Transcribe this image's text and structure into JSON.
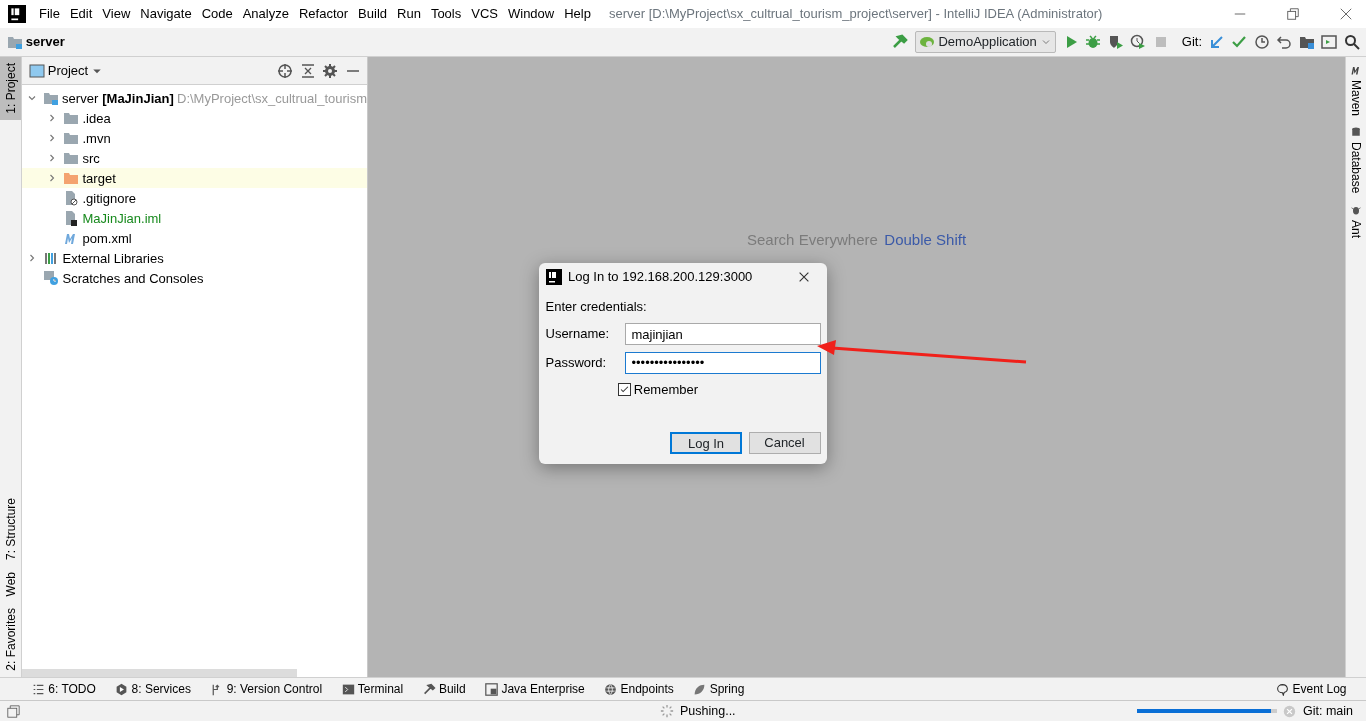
{
  "window": {
    "title": "server [D:\\MyProject\\sx_cultrual_tourism_project\\server] - IntelliJ IDEA (Administrator)",
    "menu": [
      "File",
      "Edit",
      "View",
      "Navigate",
      "Code",
      "Analyze",
      "Refactor",
      "Build",
      "Run",
      "Tools",
      "VCS",
      "Window",
      "Help"
    ]
  },
  "navbar": {
    "breadcrumb": "server",
    "run_config": "DemoApplication",
    "git_label": "Git:"
  },
  "left_stripe": {
    "top": [
      {
        "label": "1: Project",
        "selected": true
      }
    ],
    "bottom": [
      {
        "label": "7: Structure",
        "selected": false
      },
      {
        "label": "Web",
        "selected": false
      },
      {
        "label": "2: Favorites",
        "selected": false
      }
    ]
  },
  "right_stripe": [
    "Maven",
    "Database",
    "Ant"
  ],
  "project_panel": {
    "title": "Project",
    "tree": [
      {
        "name": "server",
        "module": "[MaJinJian]",
        "path": "D:\\MyProject\\sx_cultrual_tourism",
        "kind": "module",
        "expanded": true,
        "selected": false,
        "children": [
          {
            "name": ".idea",
            "kind": "folder",
            "expanded": false,
            "selected": false
          },
          {
            "name": ".mvn",
            "kind": "folder",
            "expanded": false,
            "selected": false
          },
          {
            "name": "src",
            "kind": "folder",
            "expanded": false,
            "selected": false
          },
          {
            "name": "target",
            "kind": "excluded",
            "expanded": false,
            "selected": true
          },
          {
            "name": ".gitignore",
            "kind": "ignore",
            "selected": false
          },
          {
            "name": "MaJinJian.iml",
            "kind": "iml",
            "selected": false,
            "color": "#16891c"
          },
          {
            "name": "pom.xml",
            "kind": "maven",
            "selected": false
          }
        ]
      },
      {
        "name": "External Libraries",
        "kind": "libraries",
        "expanded": false,
        "selected": false
      },
      {
        "name": "Scratches and Consoles",
        "kind": "scratches",
        "selected": false
      }
    ]
  },
  "editor_hint": {
    "action": "Search Everywhere",
    "shortcut": "Double Shift"
  },
  "dialog": {
    "title": "Log In to 192.168.200.129:3000",
    "prompt": "Enter credentials:",
    "fields": [
      {
        "label": "Username:",
        "value": "majinjian",
        "focused": false
      },
      {
        "label": "Password:",
        "value": "••••••••••••••••",
        "focused": true
      }
    ],
    "remember": {
      "label": "Remember",
      "checked": true
    },
    "buttons": [
      {
        "label": "Log In",
        "default": true
      },
      {
        "label": "Cancel",
        "default": false
      }
    ]
  },
  "tool_windows": [
    {
      "label": "6: TODO",
      "kind": "todo"
    },
    {
      "label": "8: Services",
      "kind": "services"
    },
    {
      "label": "9: Version Control",
      "kind": "vcs"
    },
    {
      "label": "Terminal",
      "kind": "terminal"
    },
    {
      "label": "Build",
      "kind": "build"
    },
    {
      "label": "Java Enterprise",
      "kind": "javaee"
    },
    {
      "label": "Endpoints",
      "kind": "endpoints"
    },
    {
      "label": "Spring",
      "kind": "spring"
    }
  ],
  "event_log": "Event Log",
  "status_bar": {
    "task": "Pushing...",
    "level": 0.96,
    "branch": "Git: main"
  }
}
